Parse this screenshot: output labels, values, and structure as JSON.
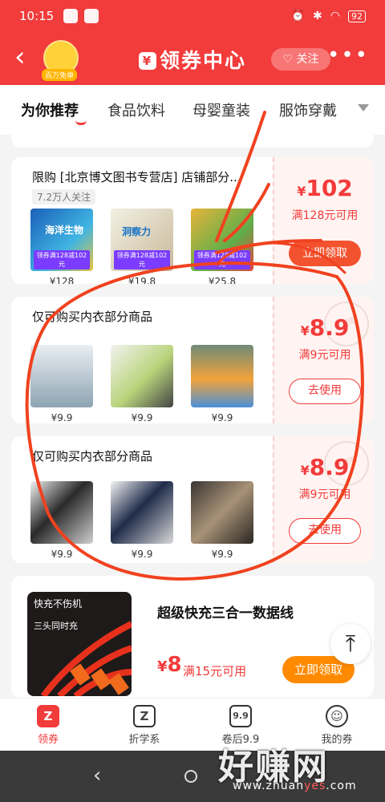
{
  "status_bar": {
    "time": "10:15",
    "battery": "92"
  },
  "header": {
    "back_icon": "‹",
    "badge": "百万免单",
    "title_icon": "¥",
    "title": "领券中心",
    "follow": "关注",
    "more_icon": "•••"
  },
  "tabs": [
    "为你推荐",
    "食品饮料",
    "母婴童装",
    "服饰穿戴"
  ],
  "cards": [
    {
      "title": "限购 [北京博文图书专营店] 店铺部分...",
      "followers": "7.2万人关注",
      "amount_symbol": "¥",
      "amount": "102",
      "condition": "满128元可用",
      "button": "立即领取",
      "products": [
        {
          "price": "¥128",
          "tag": "领券满128减102元",
          "label": "海洋生物"
        },
        {
          "price": "¥19.8",
          "tag": "领券满128减102元",
          "label": "洞察力"
        },
        {
          "price": "¥25.8",
          "tag": "领券满128减102元",
          "label": ""
        }
      ]
    },
    {
      "title": "仅可购买内衣部分商品",
      "amount_symbol": "¥",
      "amount": "8.9",
      "condition": "满9元可用",
      "button": "去使用",
      "stamp": "已领取",
      "products": [
        {
          "price": "¥9.9"
        },
        {
          "price": "¥9.9"
        },
        {
          "price": "¥9.9"
        }
      ]
    },
    {
      "title": "仅可购买内衣部分商品",
      "amount_symbol": "¥",
      "amount": "8.9",
      "condition": "满9元可用",
      "button": "去使用",
      "stamp": "已领取",
      "products": [
        {
          "price": "¥9.9"
        },
        {
          "price": "¥9.9"
        },
        {
          "price": "¥9.9"
        }
      ]
    }
  ],
  "cable_card": {
    "title": "超级快充三合一数据线",
    "image_text": "快充不伤机",
    "image_sub": "三头同时充",
    "amount_symbol": "¥",
    "amount": "8",
    "condition": "满15元可用",
    "button": "立即领取"
  },
  "bottom_nav": [
    {
      "label": "领券",
      "icon": "Z"
    },
    {
      "label": "折学系",
      "icon": "Z"
    },
    {
      "label": "卷后9.9",
      "icon": "9.9"
    },
    {
      "label": "我的券",
      "icon": "☺"
    }
  ],
  "watermark": {
    "text": "好赚网",
    "url_a": "www.zhuan",
    "url_b": "yes",
    "url_c": ".com"
  },
  "colors": {
    "brand": "#f23b3b",
    "orange": "#ff8a00",
    "scribble": "#f0421f"
  }
}
